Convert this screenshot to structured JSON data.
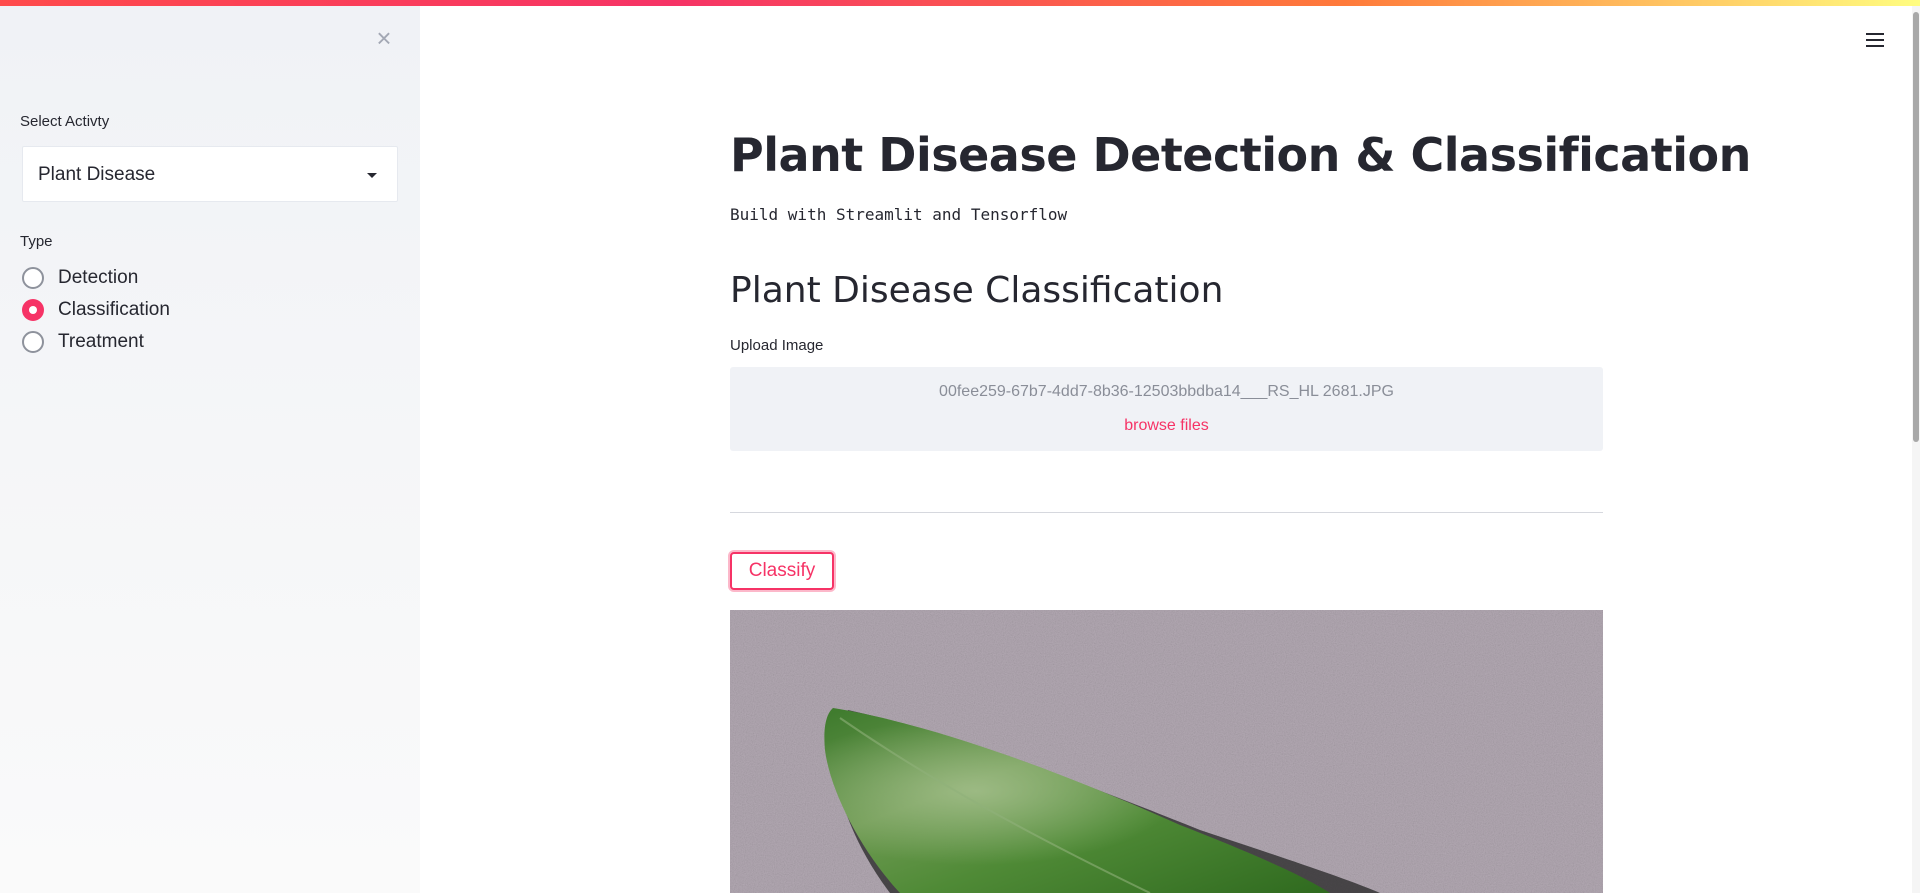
{
  "sidebar": {
    "close_symbol": "×",
    "activity_label": "Select Activty",
    "activity_selected": "Plant Disease",
    "type_label": "Type",
    "type_options": [
      {
        "label": "Detection",
        "checked": false
      },
      {
        "label": "Classification",
        "checked": true
      },
      {
        "label": "Treatment",
        "checked": false
      }
    ]
  },
  "main": {
    "title": "Plant Disease Detection & Classification",
    "subtitle": "Build with Streamlit and Tensorflow",
    "section_title": "Plant Disease Classification",
    "upload": {
      "label": "Upload Image",
      "filename": "00fee259-67b7-4dd7-8b36-12503bbdba14___RS_HL 2681.JPG",
      "browse_label": "browse files"
    },
    "classify_button": "Classify"
  },
  "icons": {
    "close": "close-icon",
    "menu": "hamburger-menu-icon",
    "caret": "caret-down-icon"
  },
  "colors": {
    "accent": "#f63366",
    "sidebar_bg": "#f0f2f6",
    "text": "#262730",
    "muted_text": "#8a8e98"
  }
}
